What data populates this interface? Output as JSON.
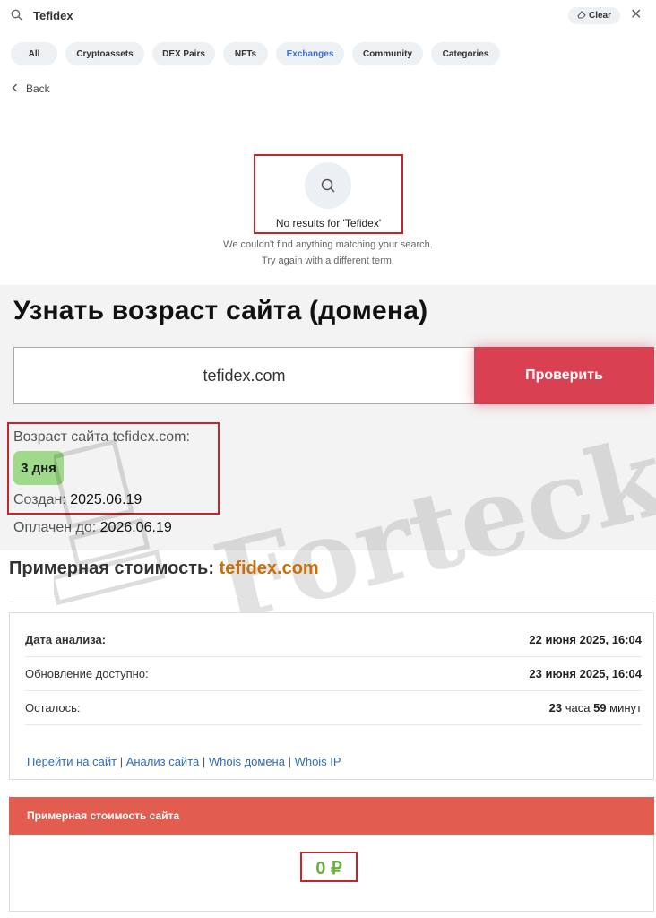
{
  "search": {
    "query": "Tefidex",
    "clear_label": "Clear"
  },
  "tabs": [
    {
      "label": "All"
    },
    {
      "label": "Cryptoassets"
    },
    {
      "label": "DEX Pairs"
    },
    {
      "label": "NFTs"
    },
    {
      "label": "Exchanges"
    },
    {
      "label": "Community"
    },
    {
      "label": "Categories"
    }
  ],
  "back_label": "Back",
  "empty_state": {
    "title": "No results for 'Tefidex'",
    "line1": "We couldn't find anything matching your search.",
    "line2": "Try again with a different term."
  },
  "domain_age": {
    "title": "Узнать возраст сайта (домена)",
    "input_value": "tefidex.com",
    "check_button": "Проверить",
    "age_label": "Возраст сайта tefidex.com:",
    "age_value": "3 дня",
    "created_label": "Создан:",
    "created_value": "2025.06.19",
    "paid_label": "Оплачен до:",
    "paid_value": "2026.06.19"
  },
  "watermark": "Forteck",
  "cost": {
    "heading_prefix": "Примерная стоимость:",
    "heading_domain": "tefidex.com",
    "rows": [
      {
        "key": "Дата анализа:",
        "value": "22 июня 2025, 16:04"
      },
      {
        "key": "Обновление доступно:",
        "value": "23 июня 2025, 16:04"
      },
      {
        "key": "Осталось:",
        "hours_num": "23",
        "hours_word": "часа",
        "mins_num": "59",
        "mins_word": "минут"
      }
    ],
    "links": [
      "Перейти на сайт",
      "Анализ сайта",
      "Whois домена",
      "Whois IP"
    ],
    "price_header": "Примерная стоимость сайта",
    "price_value": "0 ₽"
  },
  "colors": {
    "accent_red": "#d94152",
    "price_header": "#e25c4f",
    "price_green": "#6ab041",
    "domain_orange": "#c8700c",
    "tab_active": "#3b6fd1"
  }
}
